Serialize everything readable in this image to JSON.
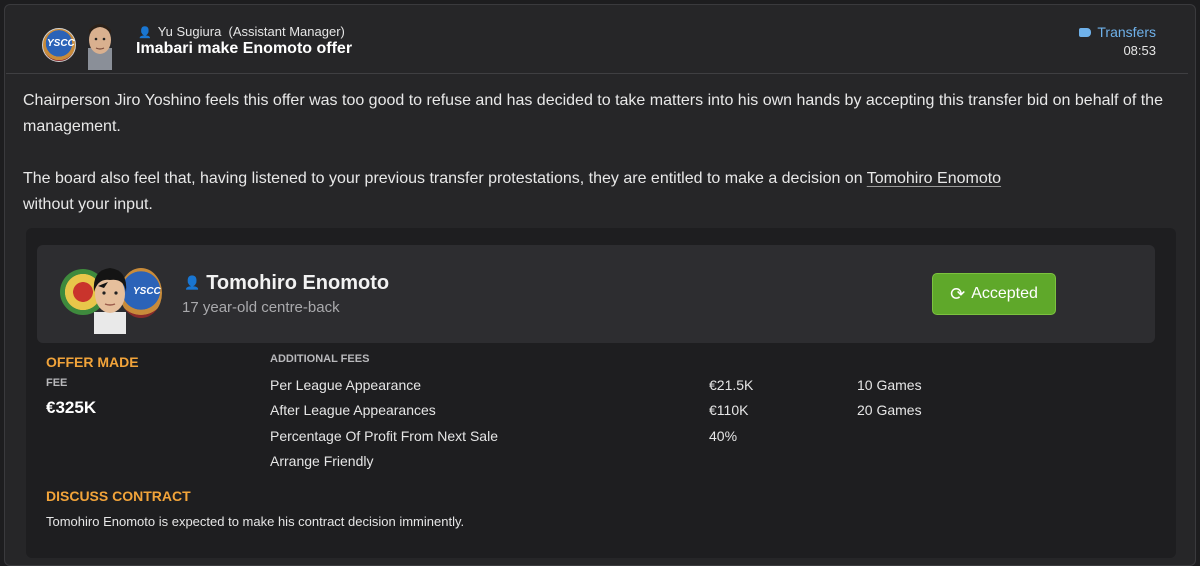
{
  "header": {
    "sender": "Yu Sugiura",
    "sender_role": "(Assistant Manager)",
    "subject": "Imabari make Enomoto offer",
    "category": "Transfers",
    "time": "08:53",
    "club_badge_text": "YSCC"
  },
  "body": {
    "paragraph1": "Chairperson Jiro Yoshino feels this offer was too good to refuse and has decided to take matters into his own hands by accepting this transfer bid on behalf of the management.",
    "paragraph2_before": "The board also feel that, having listened to your previous transfer protestations, they are entitled to make a decision on ",
    "paragraph2_link": "Tomohiro Enomoto",
    "paragraph2_after": "without your input."
  },
  "player": {
    "name": "Tomohiro Enomoto",
    "description": "17 year-old centre-back",
    "status": "Accepted"
  },
  "offer": {
    "heading": "OFFER MADE",
    "fee_label": "FEE",
    "fee_value": "€325K",
    "additional_fees_label": "ADDITIONAL FEES",
    "additional_fees": [
      {
        "label": "Per League Appearance",
        "amount": "€21.5K",
        "condition": "10 Games"
      },
      {
        "label": "After League Appearances",
        "amount": "€110K",
        "condition": "20 Games"
      },
      {
        "label": "Percentage Of Profit From Next Sale",
        "amount": "40%",
        "condition": ""
      },
      {
        "label": "Arrange Friendly",
        "amount": "",
        "condition": ""
      }
    ]
  },
  "contract": {
    "heading": "DISCUSS CONTRACT",
    "text": "Tomohiro Enomoto is expected to make his contract decision imminently."
  },
  "colors": {
    "accent_orange": "#f2a43a",
    "accepted_green": "#5fa82a",
    "link_blue": "#6fb1ea"
  }
}
